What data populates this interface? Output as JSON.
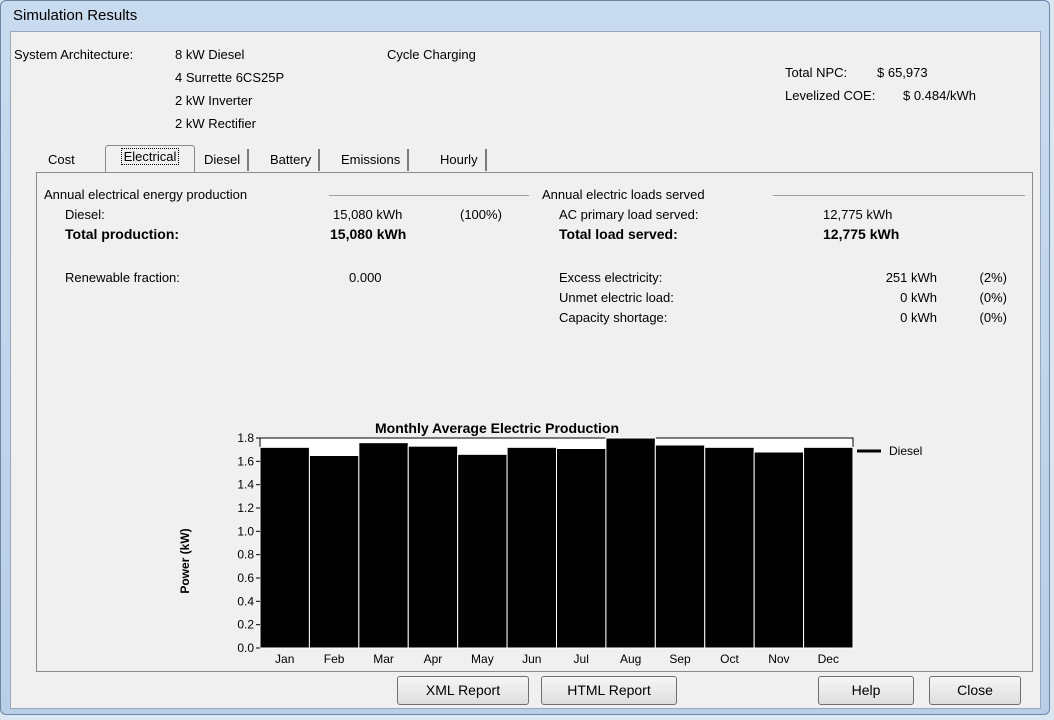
{
  "window": {
    "title": "Simulation Results"
  },
  "header": {
    "arch_label": "System Architecture:",
    "arch_items": [
      "8 kW Diesel",
      "4 Surrette 6CS25P",
      "2 kW Inverter",
      "2 kW Rectifier"
    ],
    "strategy": "Cycle Charging",
    "npc_label": "Total NPC:",
    "npc_value": "$ 65,973",
    "coe_label": "Levelized COE:",
    "coe_value": "$ 0.484/kWh"
  },
  "tabs": [
    "Cost",
    "Electrical",
    "Diesel",
    "Battery",
    "Emissions",
    "Hourly Data"
  ],
  "active_tab": "Electrical",
  "production": {
    "heading": "Annual electrical energy production",
    "diesel_label": "Diesel:",
    "diesel_value": "15,080 kWh",
    "diesel_pct": "(100%)",
    "total_label": "Total production:",
    "total_value": "15,080 kWh",
    "renew_label": "Renewable fraction:",
    "renew_value": "0.000"
  },
  "loads": {
    "heading": "Annual electric loads served",
    "ac_label": "AC primary load served:",
    "ac_value": "12,775 kWh",
    "total_label": "Total load served:",
    "total_value": "12,775 kWh",
    "rows": [
      {
        "label": "Excess electricity:",
        "value": "251 kWh",
        "pct": "(2%)"
      },
      {
        "label": "Unmet electric load:",
        "value": "0 kWh",
        "pct": "(0%)"
      },
      {
        "label": "Capacity shortage:",
        "value": "0 kWh",
        "pct": "(0%)"
      }
    ]
  },
  "chart_data": {
    "type": "bar",
    "title": "Monthly Average Electric Production",
    "ylabel": "Power (kW)",
    "xlabel": "",
    "categories": [
      "Jan",
      "Feb",
      "Mar",
      "Apr",
      "May",
      "Jun",
      "Jul",
      "Aug",
      "Sep",
      "Oct",
      "Nov",
      "Dec"
    ],
    "series": [
      {
        "name": "Diesel",
        "color": "#000000",
        "values": [
          1.72,
          1.65,
          1.76,
          1.73,
          1.66,
          1.72,
          1.71,
          1.8,
          1.74,
          1.72,
          1.68,
          1.72
        ]
      }
    ],
    "ylim": [
      0,
      1.8
    ],
    "yticks": [
      "0.0",
      "0.2",
      "0.4",
      "0.6",
      "0.8",
      "1.0",
      "1.2",
      "1.4",
      "1.6",
      "1.8"
    ],
    "legend_position": "right",
    "grid": false
  },
  "buttons": {
    "xml_report": "XML Report",
    "html_report": "HTML Report",
    "help": "Help",
    "close": "Close"
  }
}
